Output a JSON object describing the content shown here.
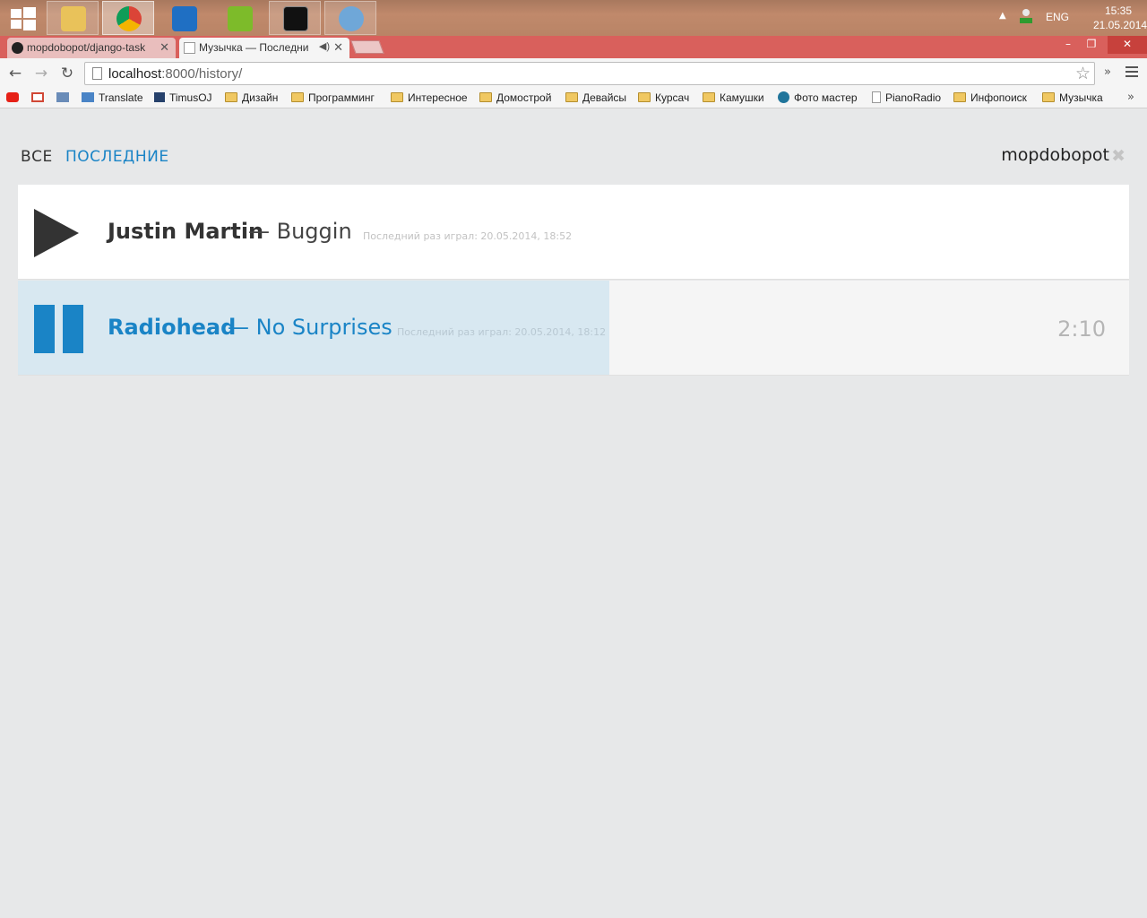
{
  "taskbar": {
    "apps": [
      {
        "name": "file-explorer-icon",
        "color": "#e9c25a"
      },
      {
        "name": "chrome-icon",
        "color": "#db4437"
      },
      {
        "name": "intellij-icon",
        "color": "#1f6fc3"
      },
      {
        "name": "pycharm-icon",
        "color": "#7dbb2a"
      },
      {
        "name": "command-prompt-icon",
        "color": "#111111"
      },
      {
        "name": "paint-icon",
        "color": "#6fa7d8"
      }
    ],
    "language": "ENG",
    "time": "15:35",
    "date": "21.05.2014"
  },
  "browser": {
    "tabs": [
      {
        "label": "mopdobopot/django-task",
        "active": false
      },
      {
        "label": "Музычка — Последни",
        "active": true
      }
    ],
    "url_host": "localhost",
    "url_path": ":8000/history/",
    "bookmarks": [
      {
        "label": "",
        "icon": "youtube-icon"
      },
      {
        "label": "",
        "icon": "gmail-icon"
      },
      {
        "label": "",
        "icon": "h-icon"
      },
      {
        "label": "Translate",
        "icon": "translate-icon"
      },
      {
        "label": "TimusOJ",
        "icon": "timus-icon"
      },
      {
        "label": "Дизайн",
        "icon": "folder-icon"
      },
      {
        "label": "Программинг",
        "icon": "folder-icon"
      },
      {
        "label": "Интересное",
        "icon": "folder-icon"
      },
      {
        "label": "Домострой",
        "icon": "folder-icon"
      },
      {
        "label": "Девайсы",
        "icon": "folder-icon"
      },
      {
        "label": "Курсач",
        "icon": "folder-icon"
      },
      {
        "label": "Камушки",
        "icon": "folder-icon"
      },
      {
        "label": "Фото мастер",
        "icon": "wordpress-icon"
      },
      {
        "label": "PianoRadio",
        "icon": "page-icon"
      },
      {
        "label": "Инфопоиск",
        "icon": "folder-icon"
      },
      {
        "label": "Музычка",
        "icon": "folder-icon"
      }
    ]
  },
  "page": {
    "nav": {
      "all": "ВСЕ",
      "recent": "ПОСЛЕДНИЕ"
    },
    "username": "mopdobopot",
    "logout_symbol": "✖",
    "accent_color": "#1a84c6",
    "tracks": [
      {
        "artist": "Justin Martin",
        "title": "— Buggin",
        "last_played": "Последний раз играл: 20.05.2014, 18:52",
        "state": "paused"
      },
      {
        "artist": "Radiohead",
        "title": "— No Surprises",
        "last_played": "Последний раз играл: 20.05.2014, 18:12",
        "state": "playing",
        "time": "2:10"
      }
    ]
  }
}
